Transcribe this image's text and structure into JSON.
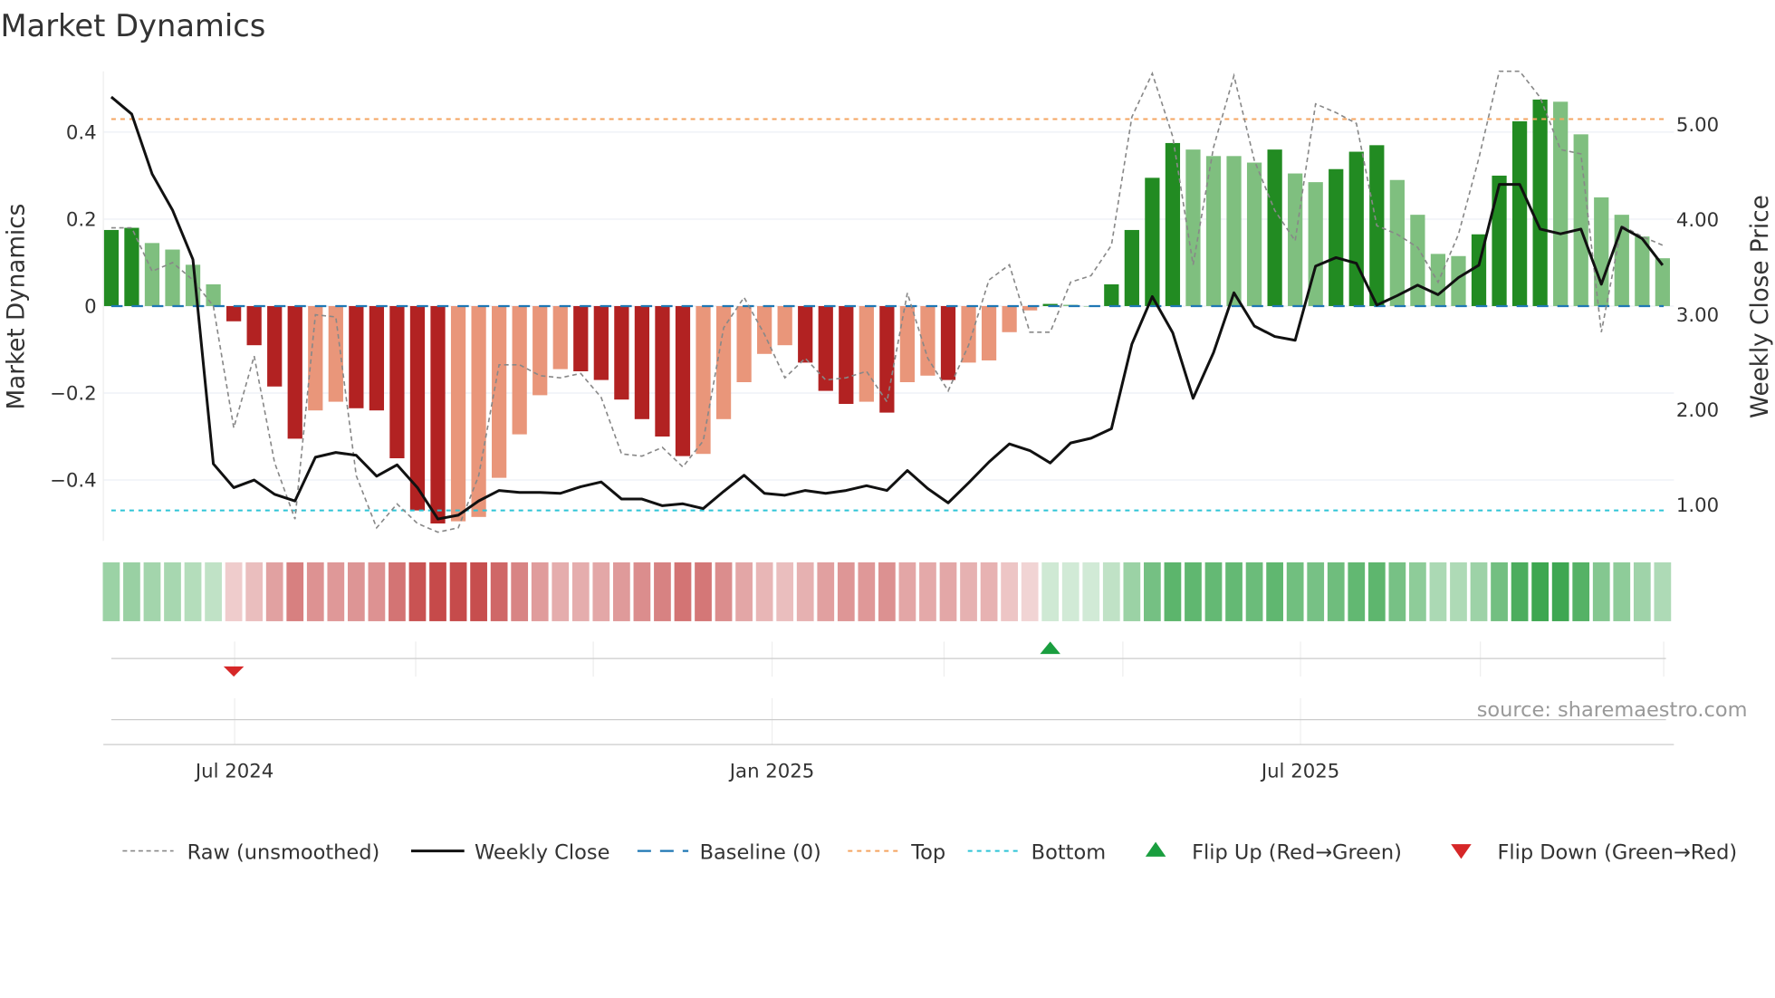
{
  "title": "Market Dynamics",
  "source": "source: sharemaestro.com",
  "chart_data": {
    "type": "bar",
    "title": "Market Dynamics",
    "ylabel": "Market Dynamics",
    "y2label": "Weekly Close Price",
    "ylim": [
      -0.54,
      0.54
    ],
    "y2lim": [
      0.62,
      5.56
    ],
    "yticks": [
      {
        "v": 0.4,
        "label": "0.4"
      },
      {
        "v": 0.2,
        "label": "0.2"
      },
      {
        "v": 0,
        "label": "0"
      },
      {
        "v": -0.2,
        "label": "−0.2"
      },
      {
        "v": -0.4,
        "label": "−0.4"
      }
    ],
    "y2ticks": [
      {
        "v": 5,
        "label": "5.00"
      },
      {
        "v": 4,
        "label": "4.00"
      },
      {
        "v": 3,
        "label": "3.00"
      },
      {
        "v": 2,
        "label": "2.00"
      },
      {
        "v": 1,
        "label": "1.00"
      }
    ],
    "xticks": [
      {
        "i": 6,
        "label": "Jul 2024"
      },
      {
        "i": 32,
        "label": "Jan 2025"
      },
      {
        "i": 58,
        "label": "Jul 2025"
      }
    ],
    "top": 0.43,
    "bottom": -0.47,
    "baseline": 0,
    "colors": {
      "up_strong": "#228b22",
      "up_weak": "#7fbf7f",
      "down_strong": "#b22222",
      "down_weak": "#e9967a",
      "baseline": "#1f77b4",
      "top": "#f4a460",
      "bottom": "#2ec4d6",
      "flip_up": "#1a9e3f",
      "flip_down": "#d62728"
    },
    "bars": [
      0.175,
      0.18,
      0.145,
      0.13,
      0.095,
      0.05,
      -0.035,
      -0.09,
      -0.185,
      -0.305,
      -0.24,
      -0.22,
      -0.235,
      -0.24,
      -0.35,
      -0.47,
      -0.5,
      -0.495,
      -0.485,
      -0.395,
      -0.295,
      -0.205,
      -0.145,
      -0.15,
      -0.17,
      -0.215,
      -0.26,
      -0.3,
      -0.345,
      -0.34,
      -0.26,
      -0.175,
      -0.11,
      -0.09,
      -0.13,
      -0.195,
      -0.225,
      -0.22,
      -0.245,
      -0.175,
      -0.16,
      -0.17,
      -0.13,
      -0.125,
      -0.06,
      -0.01,
      0.005,
      0.003,
      0.0,
      0.05,
      0.175,
      0.295,
      0.375,
      0.36,
      0.345,
      0.345,
      0.33,
      0.36,
      0.305,
      0.285,
      0.315,
      0.355,
      0.37,
      0.29,
      0.21,
      0.12,
      0.115,
      0.165,
      0.3,
      0.425,
      0.475,
      0.47,
      0.395,
      0.25,
      0.21,
      0.16,
      0.11
    ],
    "strong": [
      1,
      1,
      0,
      0,
      0,
      0,
      1,
      1,
      1,
      1,
      0,
      0,
      1,
      1,
      1,
      1,
      1,
      0,
      0,
      0,
      0,
      0,
      0,
      1,
      1,
      1,
      1,
      1,
      1,
      0,
      0,
      0,
      0,
      0,
      1,
      1,
      1,
      0,
      1,
      0,
      0,
      1,
      0,
      0,
      0,
      0,
      1,
      0,
      0,
      1,
      1,
      1,
      1,
      0,
      0,
      0,
      0,
      1,
      0,
      0,
      1,
      1,
      1,
      0,
      0,
      0,
      0,
      1,
      1,
      1,
      1,
      0,
      0,
      0,
      0,
      0,
      0
    ],
    "raw": [
      0.18,
      0.18,
      0.08,
      0.1,
      0.06,
      0.0,
      -0.28,
      -0.115,
      -0.36,
      -0.49,
      -0.02,
      -0.025,
      -0.39,
      -0.51,
      -0.455,
      -0.5,
      -0.52,
      -0.51,
      -0.39,
      -0.135,
      -0.135,
      -0.16,
      -0.165,
      -0.155,
      -0.21,
      -0.34,
      -0.345,
      -0.325,
      -0.37,
      -0.31,
      -0.05,
      0.02,
      -0.065,
      -0.165,
      -0.12,
      -0.17,
      -0.165,
      -0.15,
      -0.22,
      0.03,
      -0.12,
      -0.195,
      -0.09,
      0.06,
      0.095,
      -0.06,
      -0.06,
      0.055,
      0.07,
      0.14,
      0.435,
      0.535,
      0.39,
      0.095,
      0.365,
      0.53,
      0.335,
      0.22,
      0.15,
      0.465,
      0.445,
      0.42,
      0.185,
      0.165,
      0.135,
      0.055,
      0.165,
      0.34,
      0.54,
      0.57,
      0.48,
      0.36,
      0.35,
      -0.06,
      0.185,
      0.16,
      0.14
    ],
    "close": [
      5.29,
      5.11,
      4.48,
      4.1,
      3.58,
      1.43,
      1.18,
      1.26,
      1.11,
      1.04,
      1.5,
      1.55,
      1.52,
      1.3,
      1.42,
      1.18,
      0.85,
      0.89,
      1.04,
      1.15,
      1.13,
      1.13,
      1.12,
      1.19,
      1.24,
      1.06,
      1.06,
      0.99,
      1.01,
      0.96,
      1.14,
      1.31,
      1.12,
      1.1,
      1.15,
      1.12,
      1.15,
      1.2,
      1.15,
      1.36,
      1.17,
      1.02,
      1.23,
      1.45,
      1.64,
      1.57,
      1.44,
      1.65,
      1.7,
      1.8,
      2.69,
      3.19,
      2.81,
      2.12,
      2.6,
      3.23,
      2.88,
      2.77,
      2.73,
      3.51,
      3.6,
      3.54,
      3.1,
      3.2,
      3.31,
      3.21,
      3.39,
      3.52,
      4.37,
      4.37,
      3.9,
      3.85,
      3.9,
      3.32,
      3.92,
      3.8,
      3.52
    ],
    "flips": [
      {
        "i": 6,
        "dir": "down"
      },
      {
        "i": 46,
        "dir": "up"
      }
    ],
    "legend": [
      "Raw (unsmoothed)",
      "Weekly Close",
      "Baseline (0)",
      "Top",
      "Bottom",
      "Flip Up (Red→Green)",
      "Flip Down (Green→Red)"
    ],
    "legend_position": "bottom"
  }
}
